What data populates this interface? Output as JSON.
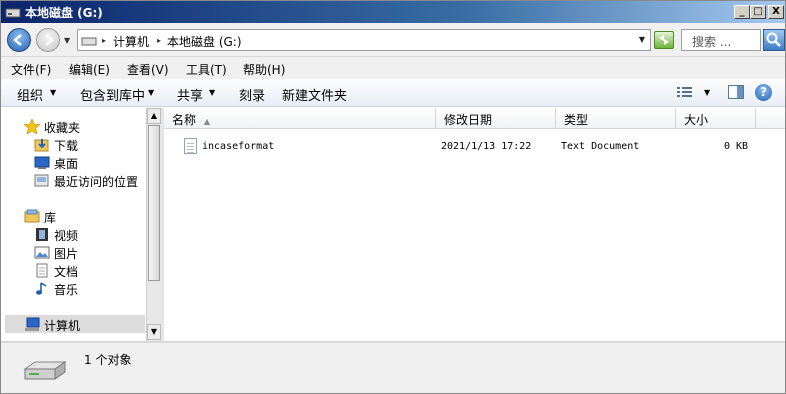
{
  "window": {
    "title": "本地磁盘 (G:)",
    "minimize": "_",
    "maximize": "□",
    "close": "X"
  },
  "address": {
    "crumbs": [
      "计算机",
      "本地磁盘 (G:)"
    ],
    "search_placeholder": "搜索 ..."
  },
  "menubar": [
    {
      "label": "文件(F)"
    },
    {
      "label": "编辑(E)"
    },
    {
      "label": "查看(V)"
    },
    {
      "label": "工具(T)"
    },
    {
      "label": "帮助(H)"
    }
  ],
  "toolbar": {
    "organize": "组织",
    "include_library": "包含到库中",
    "share": "共享",
    "burn": "刻录",
    "new_folder": "新建文件夹",
    "help": "?"
  },
  "nav": {
    "favorites": "收藏夹",
    "downloads": "下载",
    "desktop": "桌面",
    "recent": "最近访问的位置",
    "libraries": "库",
    "videos": "视频",
    "pictures": "图片",
    "documents": "文档",
    "music": "音乐",
    "computer": "计算机"
  },
  "columns": {
    "name": "名称",
    "modified": "修改日期",
    "type": "类型",
    "size": "大小"
  },
  "files": [
    {
      "name": "incaseformat",
      "modified": "2021/1/13 17:22",
      "type": "Text Document",
      "size": "0 KB"
    }
  ],
  "status": {
    "count": "1 个对象"
  }
}
